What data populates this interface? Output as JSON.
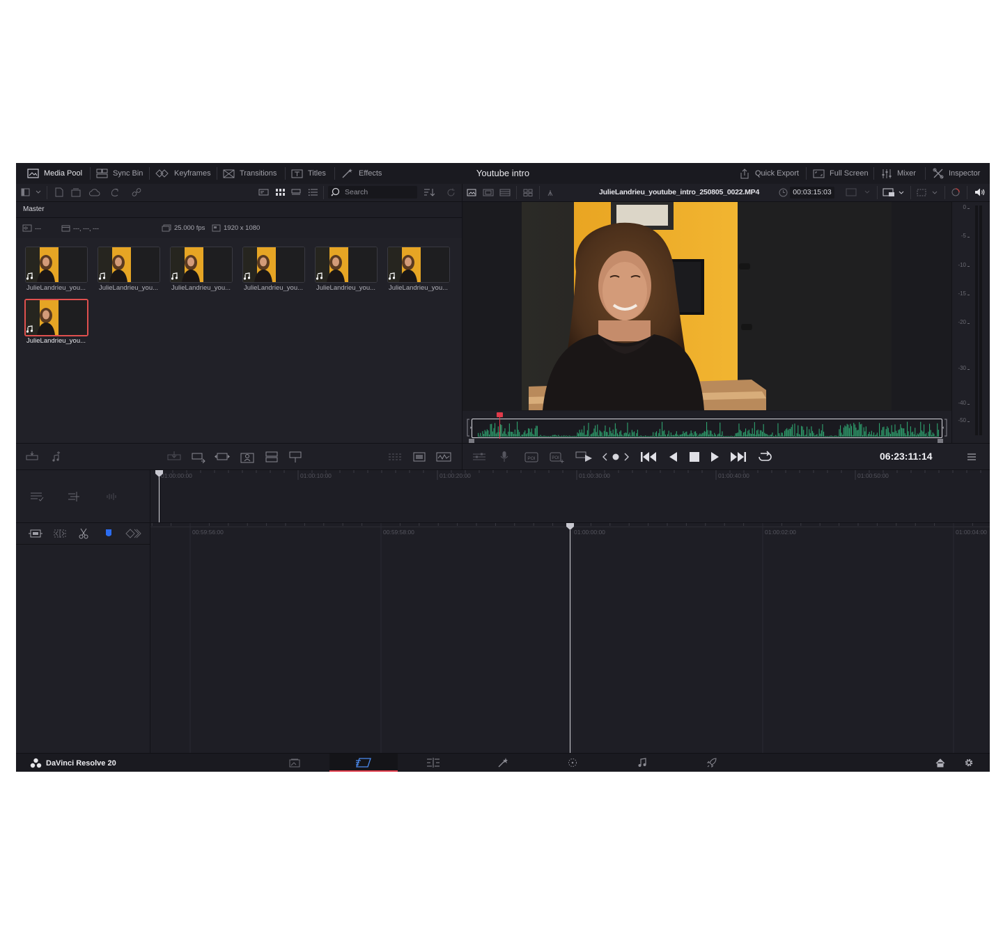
{
  "topbar": {
    "left_items": [
      {
        "label": "Media Pool",
        "icon": "media-pool-icon",
        "active": true
      },
      {
        "label": "Sync Bin",
        "icon": "sync-bin-icon",
        "active": false
      },
      {
        "label": "Keyframes",
        "icon": "keyframes-icon",
        "active": false
      },
      {
        "label": "Transitions",
        "icon": "transitions-icon",
        "active": false
      },
      {
        "label": "Titles",
        "icon": "titles-icon",
        "active": false
      },
      {
        "label": "Effects",
        "icon": "effects-icon",
        "active": false
      }
    ],
    "project_title": "Youtube intro",
    "right_items": [
      {
        "label": "Quick Export",
        "icon": "quick-export-icon"
      },
      {
        "label": "Full Screen",
        "icon": "full-screen-icon"
      },
      {
        "label": "Mixer",
        "icon": "mixer-icon"
      },
      {
        "label": "Inspector",
        "icon": "inspector-icon"
      }
    ]
  },
  "media_pool": {
    "search_placeholder": "Search",
    "bin_name": "Master",
    "info": {
      "audio": "---",
      "date": "---, ---, ---",
      "fps": "25.000 fps",
      "resolution": "1920 x 1080"
    },
    "clips": [
      {
        "name": "JulieLandrieu_you...",
        "selected": false
      },
      {
        "name": "JulieLandrieu_you...",
        "selected": false
      },
      {
        "name": "JulieLandrieu_you...",
        "selected": false
      },
      {
        "name": "JulieLandrieu_you...",
        "selected": false
      },
      {
        "name": "JulieLandrieu_you...",
        "selected": false
      },
      {
        "name": "JulieLandrieu_you...",
        "selected": false
      },
      {
        "name": "JulieLandrieu_you...",
        "selected": true
      }
    ]
  },
  "viewer": {
    "clip_name": "JulieLandrieu_youtube_intro_250805_0022.MP4",
    "clip_duration": "00:03:15:03",
    "timecode": "06:23:11:14"
  },
  "audio_meter": {
    "labels": [
      "0",
      "-5",
      "-10",
      "-15",
      "-20",
      "-30",
      "-40",
      "-50"
    ]
  },
  "upper_timeline": {
    "labels": [
      "01:00:00:00",
      "01:00:10:00",
      "01:00:20:00",
      "01:00:30:00",
      "01:00:40:00",
      "01:00:50:00"
    ]
  },
  "lower_timeline": {
    "labels": [
      "00:59:56:00",
      "00:59:58:00",
      "01:00:00:00",
      "01:00:02:00",
      "01:00:04:00"
    ]
  },
  "footer": {
    "app_name": "DaVinci Resolve 20",
    "active_page": "cut"
  },
  "colors": {
    "accent_red": "#e03a4a",
    "waveform_green": "#2fa36f",
    "app_bg": "#212128",
    "selection_red": "#e0504e",
    "flag_blue": "#2b6cf0"
  }
}
